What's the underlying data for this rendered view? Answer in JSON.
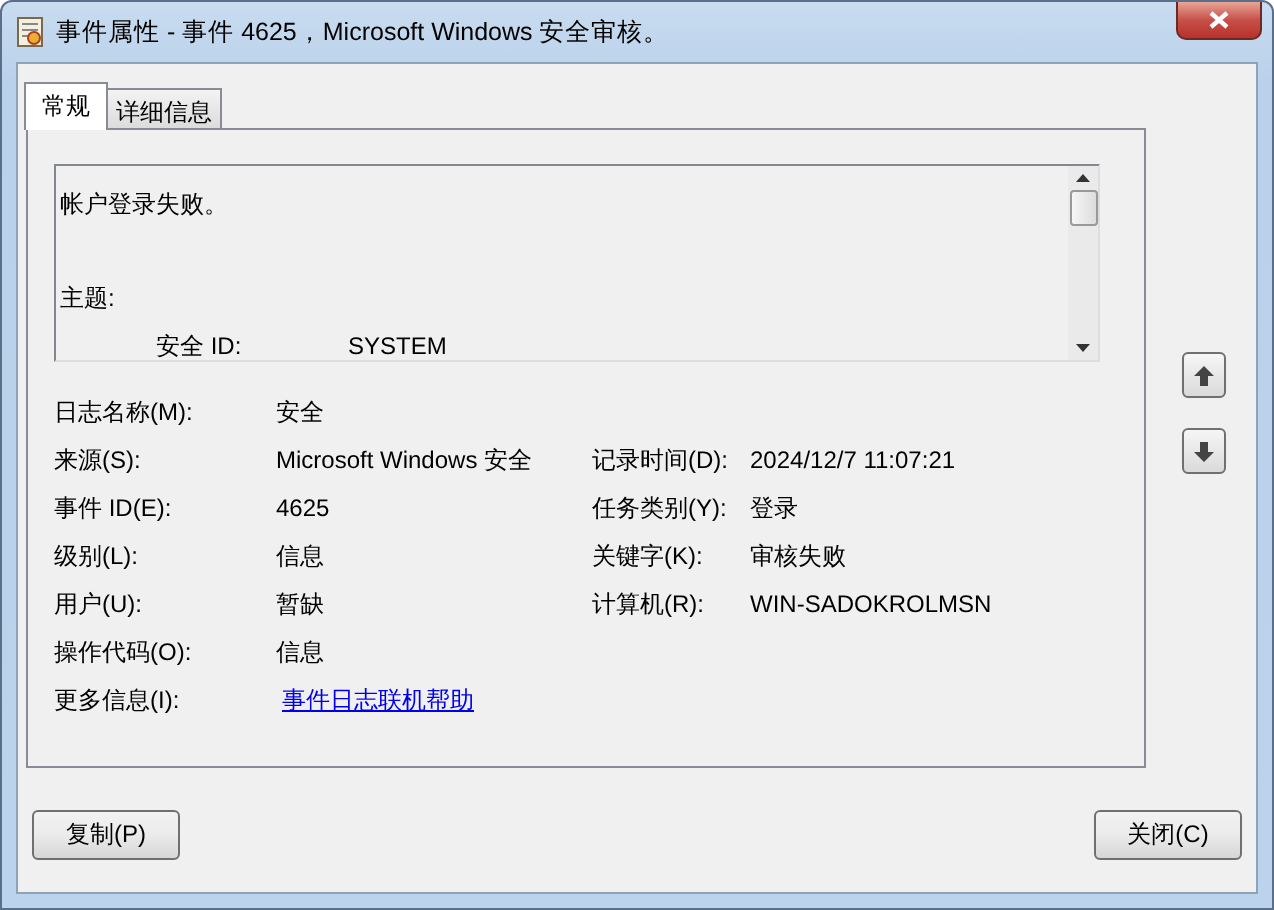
{
  "window": {
    "title": "事件属性 - 事件 4625，Microsoft Windows 安全审核。"
  },
  "tabs": [
    {
      "label": "常规",
      "selected": true
    },
    {
      "label": "详细信息",
      "selected": false
    }
  ],
  "description": {
    "lines": [
      {
        "kind": "text",
        "text": "帐户登录失败。"
      },
      {
        "kind": "blank"
      },
      {
        "kind": "text",
        "text": "主题:"
      },
      {
        "kind": "pair",
        "label": "安全 ID:",
        "value": "SYSTEM"
      }
    ]
  },
  "fields": [
    {
      "label": "日志名称(M):",
      "value": "安全"
    },
    {
      "label": "来源(S):",
      "value": "Microsoft Windows 安全",
      "label_2": "记录时间(D):",
      "value_2": "2024/12/7 11:07:21"
    },
    {
      "label": "事件 ID(E):",
      "value": "4625",
      "label_2": "任务类别(Y):",
      "value_2": "登录"
    },
    {
      "label": "级别(L):",
      "value": "信息",
      "label_2": "关键字(K):",
      "value_2": "审核失败"
    },
    {
      "label": "用户(U):",
      "value": "暂缺",
      "label_2": "计算机(R):",
      "value_2": "WIN-SADOKROLMSN"
    },
    {
      "label": "操作代码(O):",
      "value": "信息"
    },
    {
      "label": "更多信息(I):",
      "value": "事件日志联机帮助",
      "kind": "link"
    }
  ],
  "buttons": [
    {
      "label": "复制(P)"
    },
    {
      "label": "关闭(C)"
    }
  ]
}
